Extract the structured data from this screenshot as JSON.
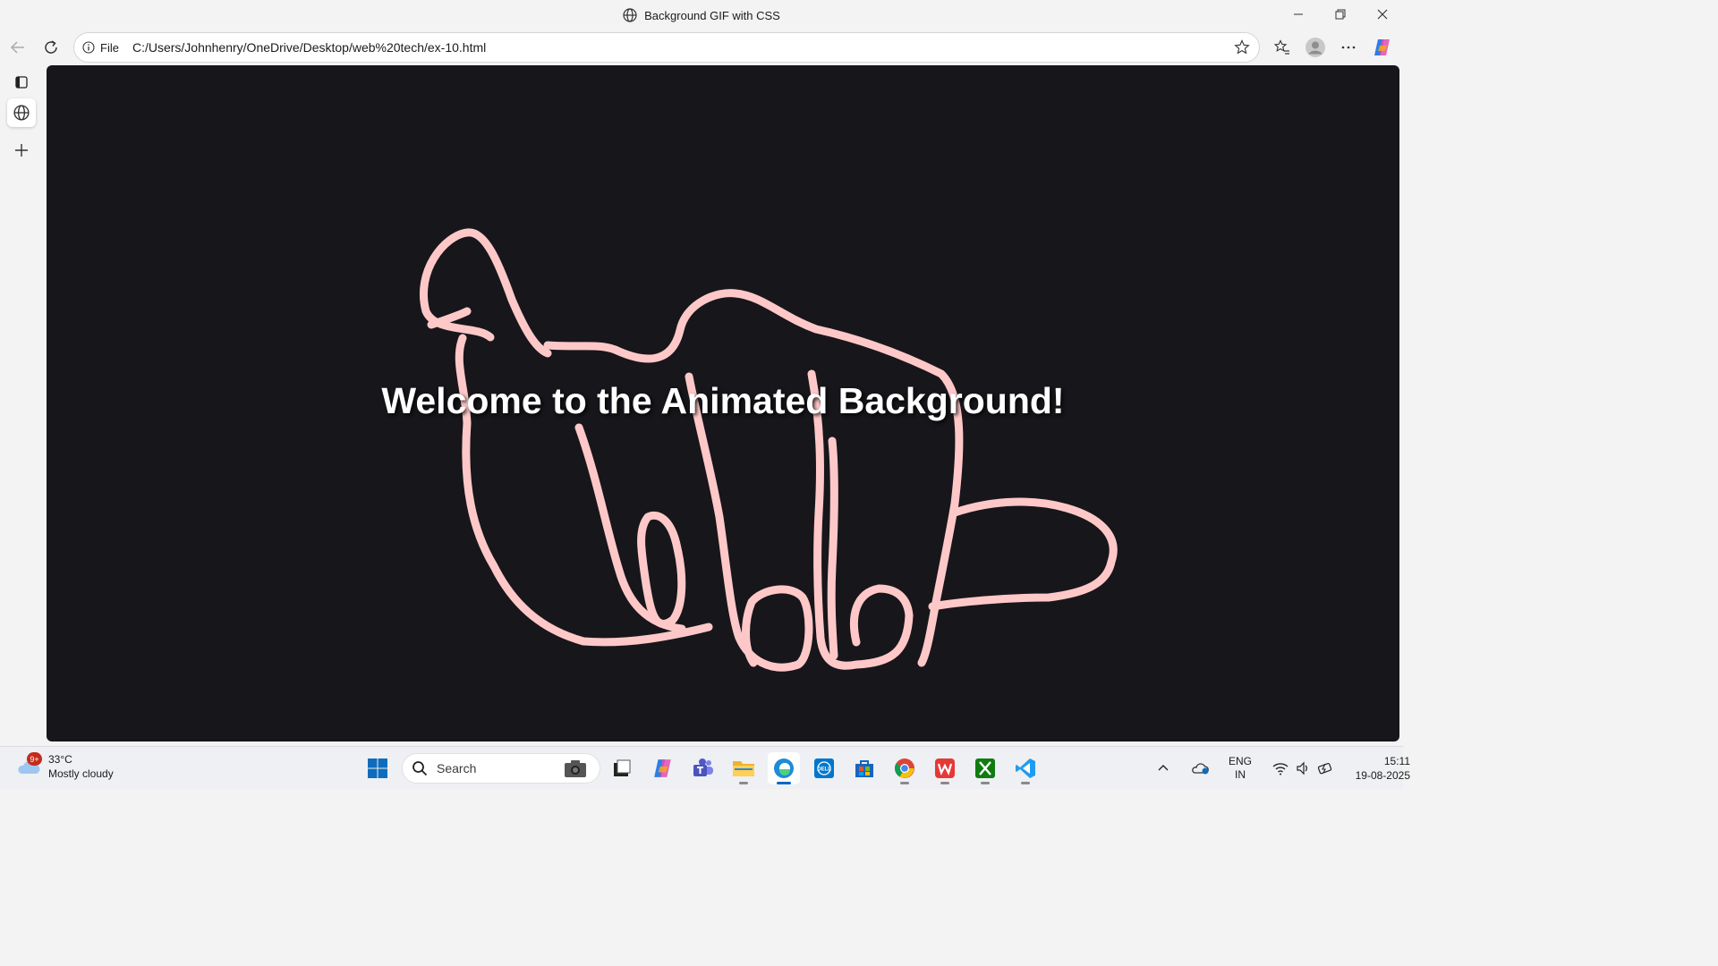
{
  "window": {
    "title": "Background GIF with CSS"
  },
  "address_bar": {
    "label": "File",
    "url": "C:/Users/Johnhenry/OneDrive/Desktop/web%20tech/ex-10.html"
  },
  "page": {
    "heading": "Welcome to the Animated Background!",
    "background": "#17161b",
    "drawing_color": "#ffc8c8"
  },
  "taskbar": {
    "weather": {
      "temp": "33°C",
      "condition": "Mostly cloudy",
      "badge": "9+"
    },
    "search_placeholder": "Search",
    "language": {
      "line1": "ENG",
      "line2": "IN"
    },
    "clock": {
      "time": "15:11",
      "date": "19-08-2025"
    }
  }
}
